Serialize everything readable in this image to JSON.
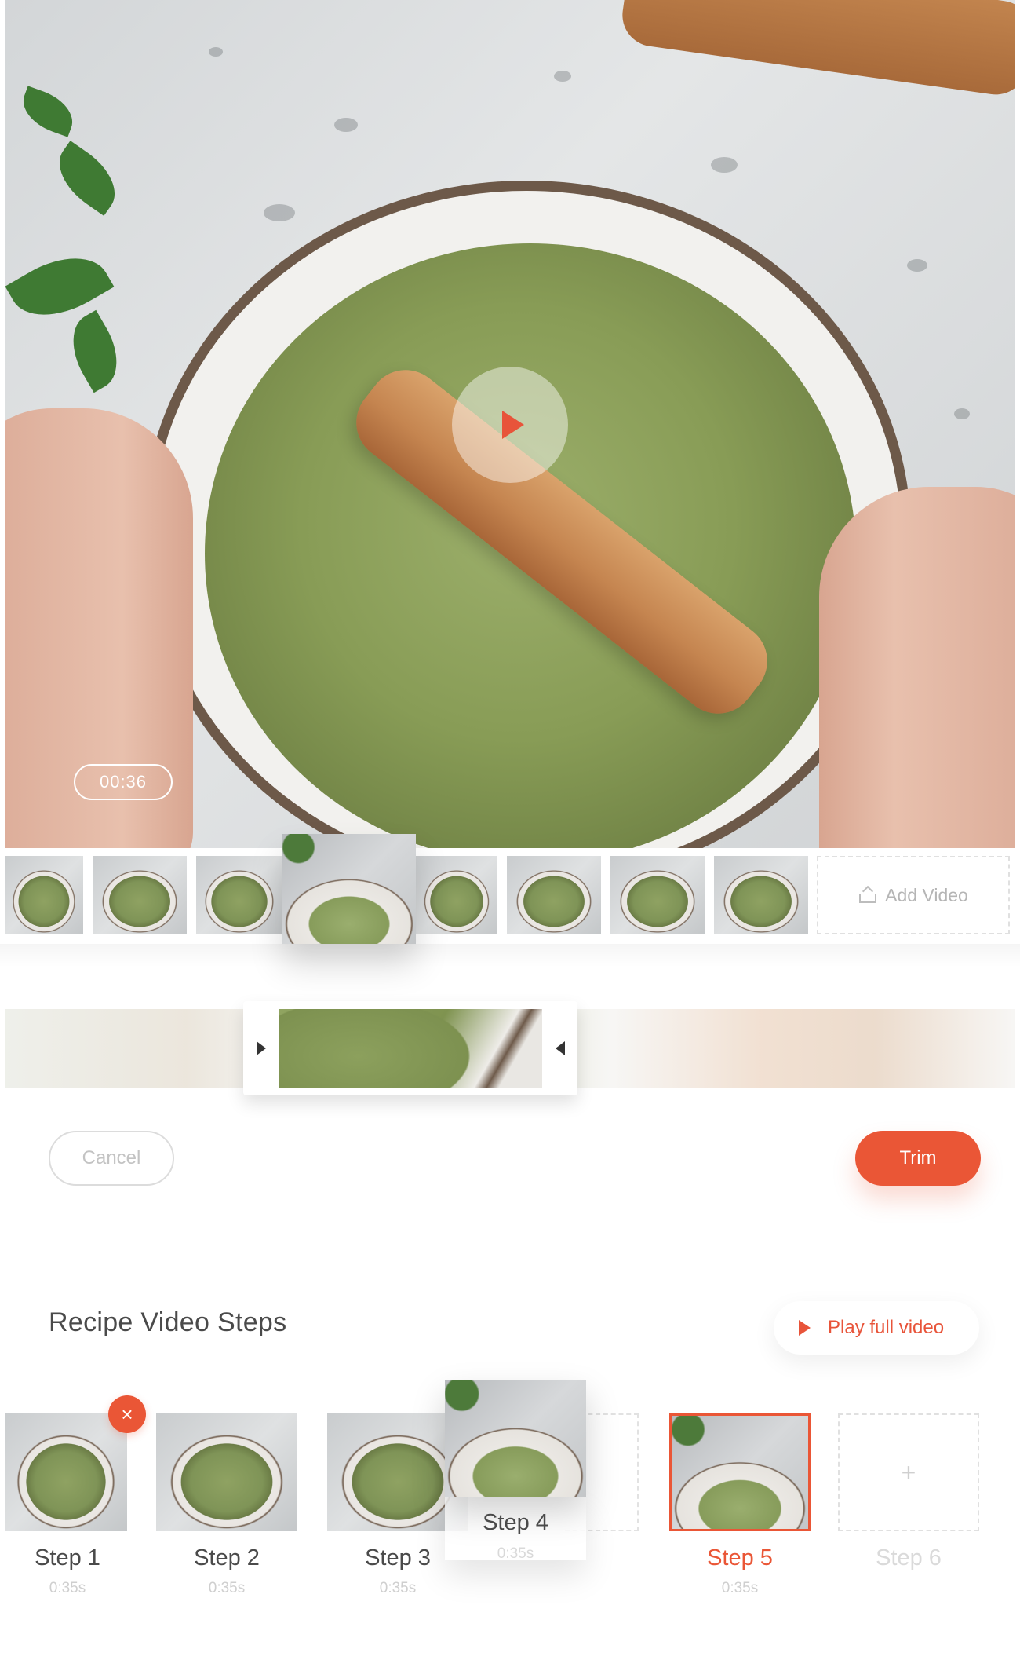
{
  "video": {
    "timestamp": "00:36",
    "play_icon": "play-icon"
  },
  "clips": {
    "add_video_label": "Add Video",
    "upload_icon": "upload-icon"
  },
  "trimmer": {
    "left_handle_icon": "triangle-right-icon",
    "right_handle_icon": "triangle-left-icon"
  },
  "actions": {
    "cancel_label": "Cancel",
    "trim_label": "Trim"
  },
  "steps_section": {
    "title": "Recipe Video Steps",
    "play_full_label": "Play full video",
    "remove_icon": "close-icon",
    "add_icon": "plus-icon",
    "steps": [
      {
        "label": "Step 1",
        "duration": "0:35s"
      },
      {
        "label": "Step 2",
        "duration": "0:35s"
      },
      {
        "label": "Step 3",
        "duration": "0:35s"
      },
      {
        "label": "Step 4",
        "duration": "0:35s"
      },
      {
        "label": "Step 5",
        "duration": "0:35s"
      },
      {
        "label": "Step 6",
        "duration": ""
      }
    ],
    "add_symbol": "+",
    "remove_symbol": "×"
  },
  "colors": {
    "accent": "#ea5636",
    "muted_text": "#c3c3c3",
    "heading": "#4a4a4a"
  }
}
